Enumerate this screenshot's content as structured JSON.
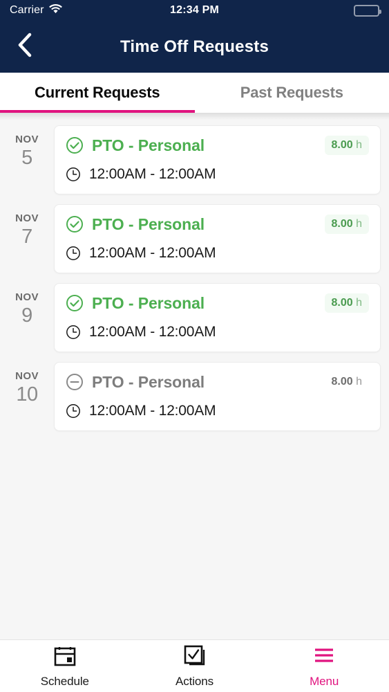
{
  "status_bar": {
    "carrier": "Carrier",
    "wifi_icon": "wifi-icon",
    "time": "12:34 PM",
    "battery_icon": "battery-full-icon"
  },
  "nav_bar": {
    "back_icon": "chevron-left-icon",
    "title": "Time Off Requests"
  },
  "tabs": [
    {
      "label": "Current Requests",
      "active": true
    },
    {
      "label": "Past Requests",
      "active": false
    }
  ],
  "colors": {
    "navy": "#10254a",
    "accent_pink": "#e0147f",
    "approved_green": "#4caf50",
    "pending_grey": "#7d7d7d",
    "page_background": "#f6f6f6",
    "card_background": "#ffffff",
    "badge_green_background": "#f2faf3"
  },
  "requests": [
    {
      "month": "NOV",
      "day": "5",
      "status": "approved",
      "status_icon": "check-circle-icon",
      "title": "PTO - Personal",
      "hours_value": "8.00",
      "hours_unit": "h",
      "clock_icon": "clock-icon",
      "time_range": "12:00AM - 12:00AM"
    },
    {
      "month": "NOV",
      "day": "7",
      "status": "approved",
      "status_icon": "check-circle-icon",
      "title": "PTO - Personal",
      "hours_value": "8.00",
      "hours_unit": "h",
      "clock_icon": "clock-icon",
      "time_range": "12:00AM - 12:00AM"
    },
    {
      "month": "NOV",
      "day": "9",
      "status": "approved",
      "status_icon": "check-circle-icon",
      "title": "PTO - Personal",
      "hours_value": "8.00",
      "hours_unit": "h",
      "clock_icon": "clock-icon",
      "time_range": "12:00AM - 12:00AM"
    },
    {
      "month": "NOV",
      "day": "10",
      "status": "pending",
      "status_icon": "minus-circle-icon",
      "title": "PTO - Personal",
      "hours_value": "8.00",
      "hours_unit": "h",
      "clock_icon": "clock-icon",
      "time_range": "12:00AM - 12:00AM"
    }
  ],
  "bottom_nav": [
    {
      "label": "Schedule",
      "icon": "calendar-icon",
      "active": false
    },
    {
      "label": "Actions",
      "icon": "checkbox-stack-icon",
      "active": false
    },
    {
      "label": "Menu",
      "icon": "hamburger-menu-icon",
      "active": true
    }
  ]
}
